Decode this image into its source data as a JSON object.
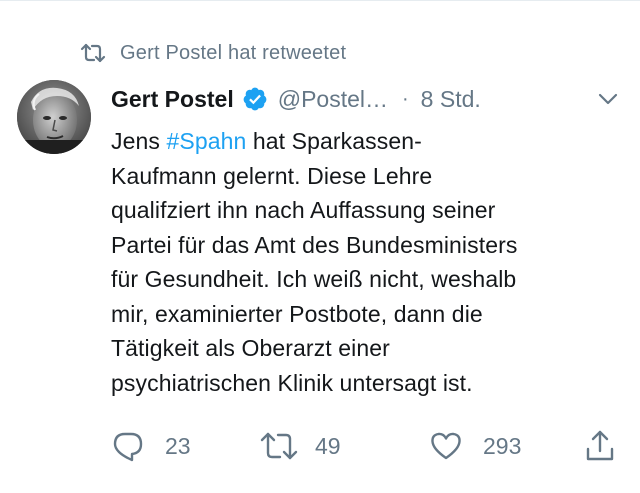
{
  "retweet_banner": {
    "text": "Gert Postel hat retweetet",
    "icon": "retweet-icon"
  },
  "author": {
    "display_name": "Gert Postel",
    "handle": "@Postel…",
    "verified": true,
    "verified_color": "#1da1f2",
    "avatar": "avatar-photo"
  },
  "meta": {
    "separator": "·",
    "timestamp": "8 Std."
  },
  "tweet": {
    "lines": [
      {
        "before": "Jens ",
        "hashtag": "#Spahn",
        "after": " hat Sparkassen-"
      },
      "Kaufmann gelernt. Diese Lehre",
      "qualifziert ihn nach Auffassung seiner",
      "Partei für das Amt des Bundesministers",
      "für Gesundheit. Ich weiß nicht, weshalb",
      "mir, examinierter Postbote, dann die",
      "Tätigkeit als Oberarzt einer",
      "psychiatrischen Klinik untersagt ist."
    ],
    "hashtag_color": "#1da1f2"
  },
  "actions": {
    "reply": {
      "icon": "reply-icon",
      "count": "23"
    },
    "retweet": {
      "icon": "retweet-icon",
      "count": "49"
    },
    "like": {
      "icon": "heart-icon",
      "count": "293"
    },
    "share": {
      "icon": "share-icon"
    }
  },
  "colors": {
    "text_primary": "#14171a",
    "text_secondary": "#657786",
    "accent": "#1da1f2"
  }
}
